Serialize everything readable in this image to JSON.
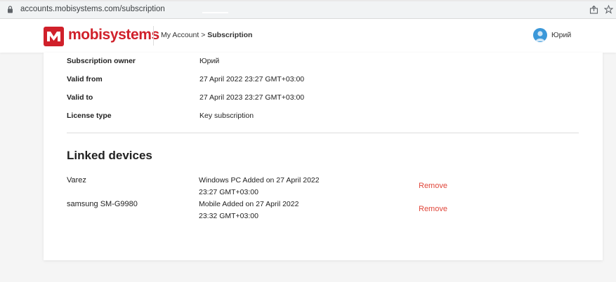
{
  "browser": {
    "url": "accounts.mobisystems.com/subscription"
  },
  "header": {
    "brand": "mobisystems",
    "breadcrumb_parent": "My Account",
    "breadcrumb_sep": ">",
    "breadcrumb_current": "Subscription",
    "user_name": "Юрий"
  },
  "details": [
    {
      "label": "Subscription owner",
      "value": "Юрий"
    },
    {
      "label": "Valid from",
      "value": "27 April 2022 23:27 GMT+03:00"
    },
    {
      "label": "Valid to",
      "value": "27 April 2023 23:27 GMT+03:00"
    },
    {
      "label": "License type",
      "value": "Key subscription"
    }
  ],
  "linked_devices": {
    "title": "Linked devices",
    "items": [
      {
        "name": "Varez",
        "info_line1": "Windows PC Added on 27 April 2022",
        "info_line2": "23:27 GMT+03:00",
        "action": "Remove"
      },
      {
        "name": "samsung SM-G9980",
        "info_line1": "Mobile Added on 27 April 2022",
        "info_line2": "23:32 GMT+03:00",
        "action": "Remove"
      }
    ]
  },
  "colors": {
    "brand": "#d0202a",
    "remove_link": "#e0463a",
    "avatar": "#3b98d9"
  }
}
